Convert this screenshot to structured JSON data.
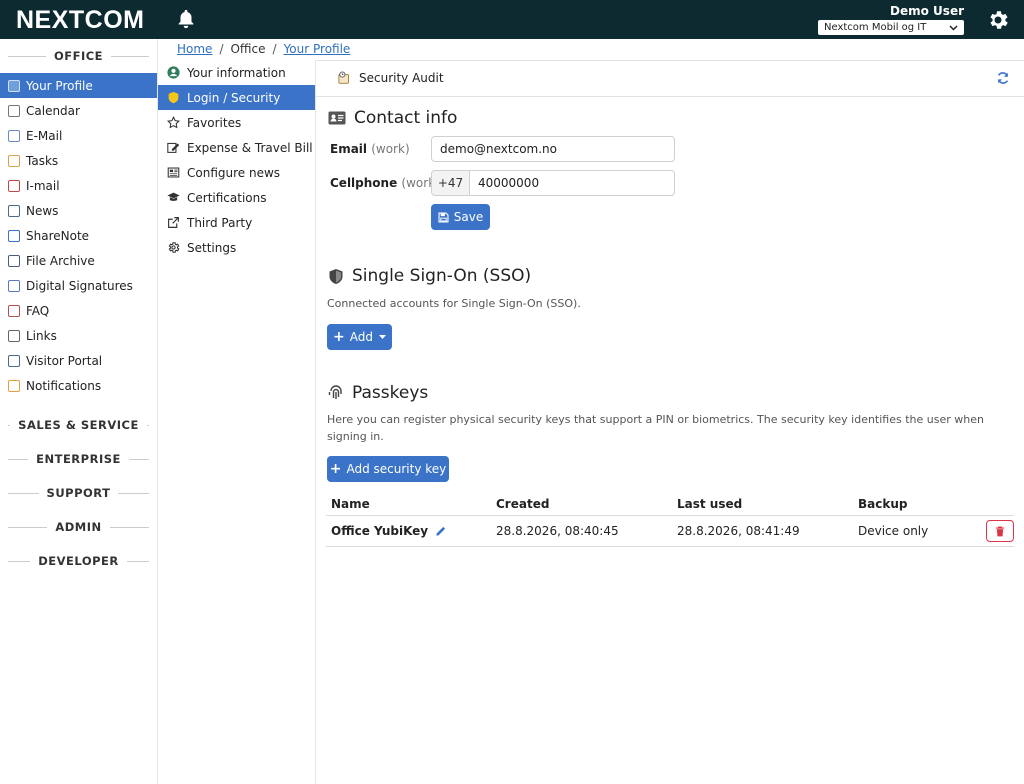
{
  "header": {
    "logo": "NEXTCOM",
    "user_name": "Demo User",
    "company": "Nextcom Mobil og IT"
  },
  "leftnav": {
    "office_title": "OFFICE",
    "items": [
      {
        "label": "Your Profile",
        "icon": "profile-icon"
      },
      {
        "label": "Calendar",
        "icon": "calendar-icon"
      },
      {
        "label": "E-Mail",
        "icon": "email-icon"
      },
      {
        "label": "Tasks",
        "icon": "tasks-icon"
      },
      {
        "label": "I-mail",
        "icon": "imail-icon"
      },
      {
        "label": "News",
        "icon": "news-icon"
      },
      {
        "label": "ShareNote",
        "icon": "sharenote-icon"
      },
      {
        "label": "File Archive",
        "icon": "file-archive-icon"
      },
      {
        "label": "Digital Signatures",
        "icon": "signature-icon"
      },
      {
        "label": "FAQ",
        "icon": "faq-icon"
      },
      {
        "label": "Links",
        "icon": "links-icon"
      },
      {
        "label": "Visitor Portal",
        "icon": "visitor-icon"
      },
      {
        "label": "Notifications",
        "icon": "notifications-icon"
      }
    ],
    "sections": [
      "SALES & SERVICE",
      "ENTERPRISE",
      "SUPPORT",
      "ADMIN",
      "DEVELOPER"
    ]
  },
  "breadcrumb": {
    "home": "Home",
    "office": "Office",
    "profile": "Your Profile"
  },
  "subnav": {
    "items": [
      {
        "label": "Your information",
        "icon": "user-circle-icon"
      },
      {
        "label": "Login / Security",
        "icon": "shield-icon"
      },
      {
        "label": "Favorites",
        "icon": "star-icon"
      },
      {
        "label": "Expense & Travel Bill",
        "icon": "edit-icon"
      },
      {
        "label": "Configure news",
        "icon": "newspaper-icon"
      },
      {
        "label": "Certifications",
        "icon": "graduation-icon"
      },
      {
        "label": "Third Party",
        "icon": "external-link-icon"
      },
      {
        "label": "Settings",
        "icon": "gear-icon"
      }
    ]
  },
  "main": {
    "tab_label": "Security Audit",
    "contact": {
      "title": "Contact info",
      "email_label": "Email",
      "email_type": "(work)",
      "email_value": "demo@nextcom.no",
      "cell_label": "Cellphone",
      "cell_type": "(work)",
      "cell_prefix": "+47",
      "cell_value": "40000000",
      "save_label": "Save"
    },
    "sso": {
      "title": "Single Sign-On (SSO)",
      "desc": "Connected accounts for Single Sign-On (SSO).",
      "add_label": "Add"
    },
    "passkeys": {
      "title": "Passkeys",
      "desc": "Here you can register physical security keys that support a PIN or biometrics. The security key identifies the user when signing in.",
      "add_label": "Add security key",
      "headers": [
        "Name",
        "Created",
        "Last used",
        "Backup"
      ],
      "rows": [
        {
          "name": "Office YubiKey",
          "created": "28.8.2026, 08:40:45",
          "last_used": "28.8.2026, 08:41:49",
          "backup": "Device only"
        }
      ]
    }
  },
  "colors": {
    "topbar": "#0d2a30",
    "accent": "#3a73c8",
    "danger": "#dc3545"
  }
}
